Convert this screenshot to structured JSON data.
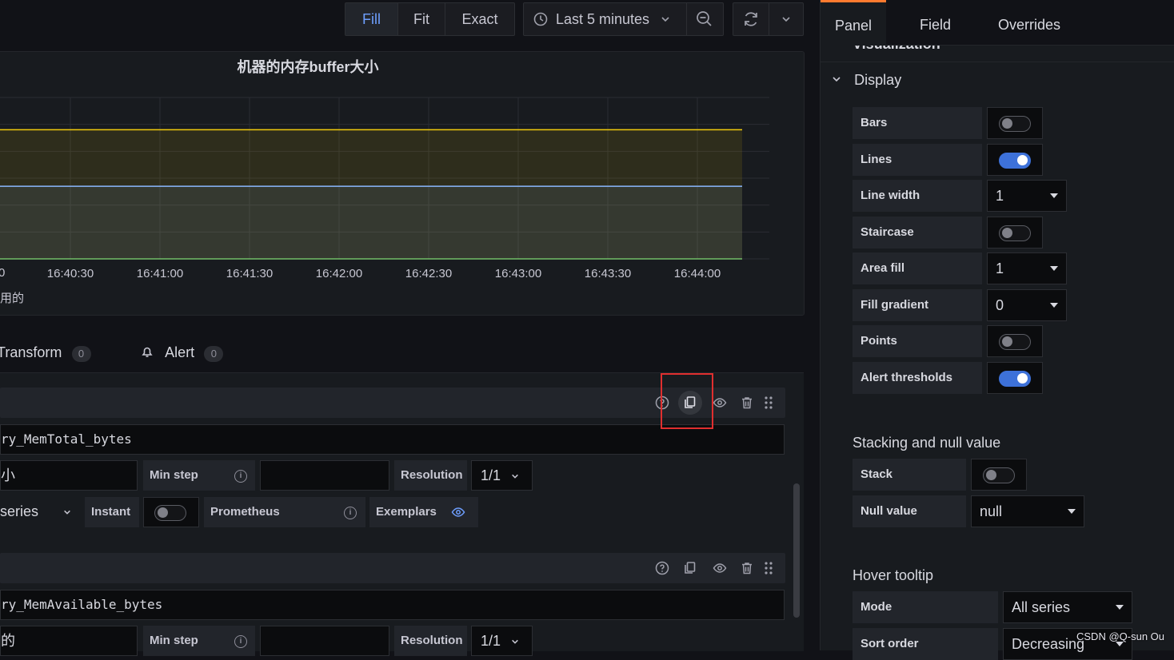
{
  "toolbar": {
    "zoom_modes": [
      "Fill",
      "Fit",
      "Exact"
    ],
    "active_zoom": "Fill",
    "time_range": "Last 5 minutes"
  },
  "panel": {
    "title": "机器的内存buffer大小",
    "legend_fragment": "用的",
    "x_axis_clipped_label": "0",
    "x_ticks": [
      "16:40:30",
      "16:41:00",
      "16:41:30",
      "16:42:00",
      "16:42:30",
      "16:43:00",
      "16:43:30",
      "16:44:00"
    ]
  },
  "chart_data": {
    "type": "area",
    "x": [
      "16:40:30",
      "16:41:00",
      "16:41:30",
      "16:42:00",
      "16:42:30",
      "16:43:00",
      "16:43:30",
      "16:44:00"
    ],
    "series": [
      {
        "color": "#f2cc0c",
        "values": [
          0.8,
          0.8,
          0.8,
          0.8,
          0.8,
          0.8,
          0.8,
          0.8
        ]
      },
      {
        "color": "#8ab8ff",
        "values": [
          0.45,
          0.45,
          0.45,
          0.45,
          0.45,
          0.45,
          0.45,
          0.45
        ]
      }
    ],
    "grid": true
  },
  "editor_tabs": {
    "transform_label": "Transform",
    "transform_count": "0",
    "alert_label": "Alert",
    "alert_count": "0"
  },
  "queries": [
    {
      "expr": "ry_MemTotal_bytes",
      "legend_fragment": "小",
      "min_step_label": "Min step",
      "resolution_label": "Resolution",
      "resolution_value": "1/1",
      "format_value": "series",
      "instant_label": "Instant",
      "type_label": "Prometheus",
      "exemplars_label": "Exemplars"
    },
    {
      "expr": "ry_MemAvailable_bytes",
      "legend_fragment": "的",
      "min_step_label": "Min step",
      "resolution_label": "Resolution",
      "resolution_value": "1/1"
    }
  ],
  "options": {
    "tabs": [
      "Panel",
      "Field",
      "Overrides"
    ],
    "active_tab": "Panel",
    "clipped_section": "Visualization",
    "display_title": "Display",
    "display": {
      "bars": "Bars",
      "lines": "Lines",
      "line_width": "Line width",
      "line_width_value": "1",
      "staircase": "Staircase",
      "area_fill": "Area fill",
      "area_fill_value": "1",
      "fill_gradient": "Fill gradient",
      "fill_gradient_value": "0",
      "points": "Points",
      "alert_thresholds": "Alert thresholds"
    },
    "stacking_title": "Stacking and null value",
    "stacking": {
      "stack": "Stack",
      "null_value": "Null value",
      "null_value_value": "null"
    },
    "tooltip_title": "Hover tooltip",
    "tooltip": {
      "mode": "Mode",
      "mode_value": "All series",
      "sort_order": "Sort order",
      "sort_order_value": "Decreasing"
    }
  },
  "watermark": "CSDN @Q-sun Ou",
  "colors": {
    "accent": "#6e9fff",
    "toggle_on": "#3d71d9",
    "highlight_box": "#e02f2f",
    "active_tab_bar": "#ff7a2f"
  }
}
